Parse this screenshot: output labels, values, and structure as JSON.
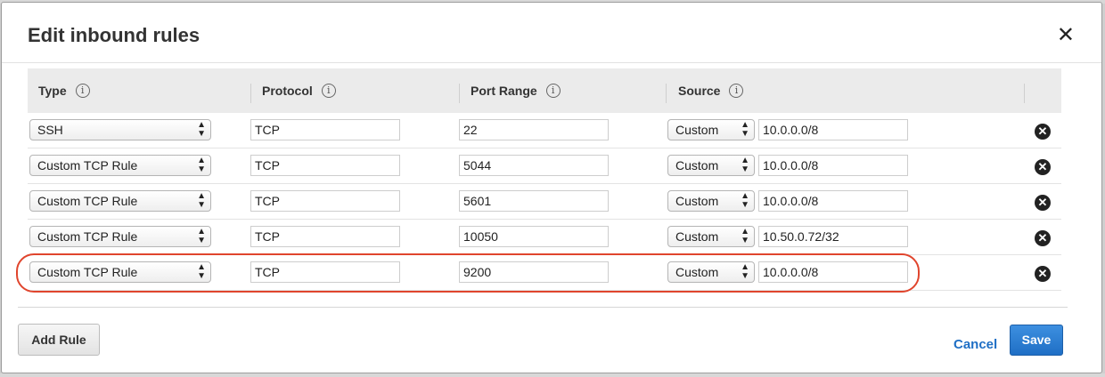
{
  "modal": {
    "title": "Edit inbound rules",
    "close_glyph": "✕"
  },
  "columns": [
    {
      "label": "Type",
      "info": "i"
    },
    {
      "label": "Protocol",
      "info": "i"
    },
    {
      "label": "Port Range",
      "info": "i"
    },
    {
      "label": "Source",
      "info": "i"
    }
  ],
  "rules": [
    {
      "type": "SSH",
      "protocol": "TCP",
      "port": "22",
      "source_mode": "Custom",
      "source": "10.0.0.0/8"
    },
    {
      "type": "Custom TCP Rule",
      "protocol": "TCP",
      "port": "5044",
      "source_mode": "Custom",
      "source": "10.0.0.0/8"
    },
    {
      "type": "Custom TCP Rule",
      "protocol": "TCP",
      "port": "5601",
      "source_mode": "Custom",
      "source": "10.0.0.0/8"
    },
    {
      "type": "Custom TCP Rule",
      "protocol": "TCP",
      "port": "10050",
      "source_mode": "Custom",
      "source": "10.50.0.72/32"
    },
    {
      "type": "Custom TCP Rule",
      "protocol": "TCP",
      "port": "9200",
      "source_mode": "Custom",
      "source": "10.0.0.0/8"
    }
  ],
  "highlighted_rule": 5,
  "remove_glyph": "✕",
  "footer": {
    "add_rule_label": "Add Rule",
    "cancel_label": "Cancel",
    "save_label": "Save"
  },
  "colors": {
    "accent": "#1f6fc5",
    "highlight": "#e0452d"
  }
}
